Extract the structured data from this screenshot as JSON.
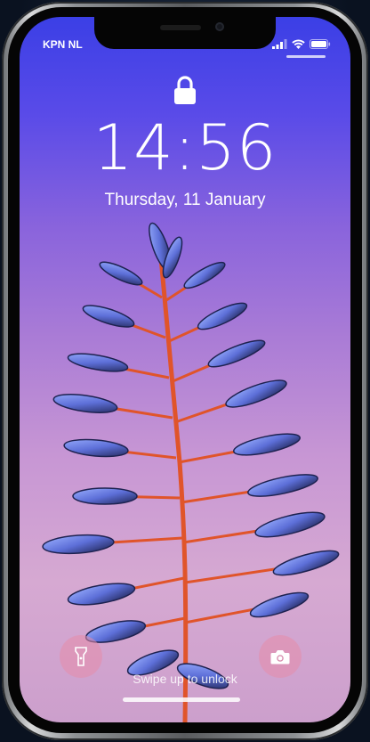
{
  "status_bar": {
    "carrier": "KPN NL",
    "icons": [
      "cellular-signal-icon",
      "wifi-icon",
      "battery-icon"
    ]
  },
  "lock_screen": {
    "lock_icon": "padlock-icon",
    "time": "14:56",
    "date": "Thursday, 11 January",
    "unlock_hint": "Swipe up to unlock",
    "wallpaper": "purple-gradient-plant"
  },
  "quick_actions": {
    "left": "flashlight-icon",
    "right": "camera-icon"
  },
  "colors": {
    "wallpaper_top": "#3b3fe6",
    "wallpaper_bottom": "#cc9fcc",
    "plant_stem": "#e0542a",
    "plant_leaf": "#6f86e6",
    "button_fill": "#e68caa"
  }
}
